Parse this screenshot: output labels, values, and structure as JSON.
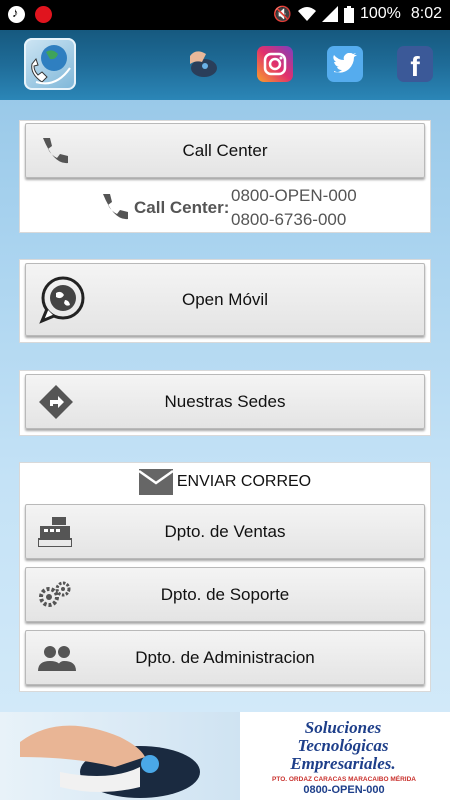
{
  "status": {
    "battery": "100%",
    "time": "8:02"
  },
  "call_center": {
    "button_label": "Call Center",
    "info_label": "Call Center:",
    "number1": "0800-OPEN-000",
    "number2": "0800-6736-000"
  },
  "open_movil": {
    "label": "Open Móvil"
  },
  "sedes": {
    "label": "Nuestras Sedes"
  },
  "email": {
    "header": "ENVIAR CORREO",
    "ventas": "Dpto. de Ventas",
    "soporte": "Dpto. de Soporte",
    "admin": "Dpto. de Administracion"
  },
  "banner": {
    "line1": "Soluciones",
    "line2": "Tecnológicas",
    "line3": "Empresariales.",
    "cities": "PTO. ORDAZ  CARACAS  MARACAIBO  MÉRIDA",
    "phone": "0800-OPEN-000"
  },
  "colors": {
    "appbar": "#1f6c98",
    "instagram": "#c13584",
    "twitter": "#55acee",
    "facebook": "#3b5998"
  }
}
